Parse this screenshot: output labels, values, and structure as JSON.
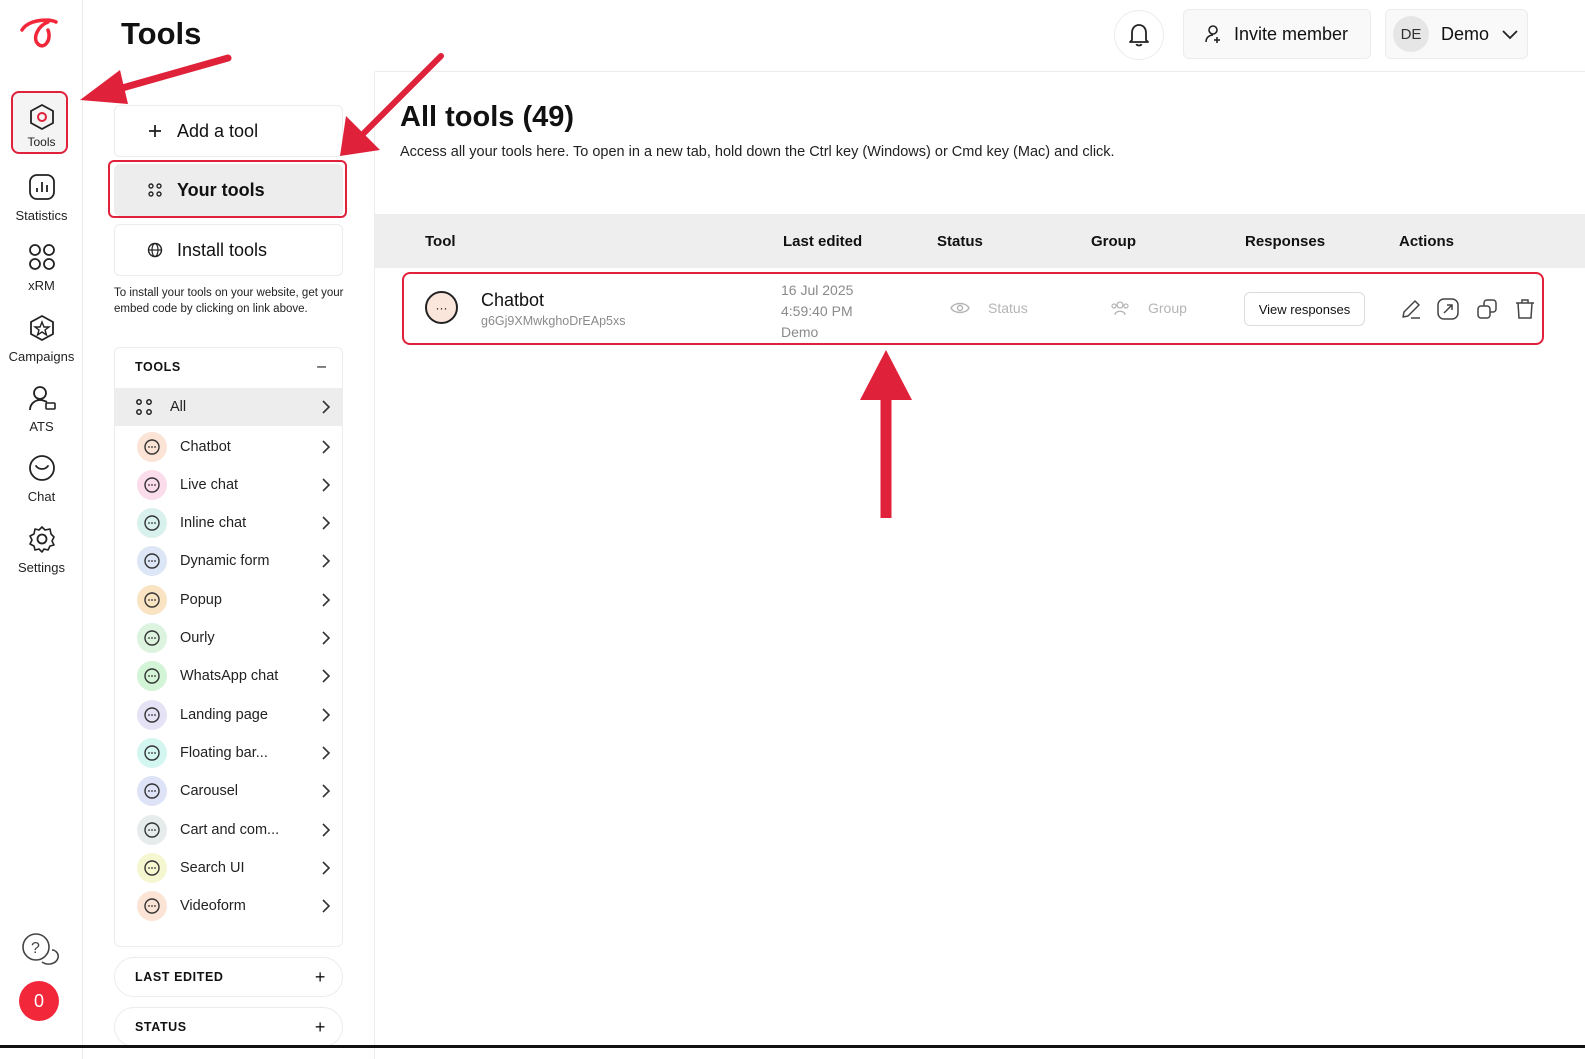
{
  "rail": {
    "items": [
      {
        "label": "Tools",
        "icon": "tools-hex-icon"
      },
      {
        "label": "Statistics",
        "icon": "statistics-icon"
      },
      {
        "label": "xRM",
        "icon": "xrm-grid-icon"
      },
      {
        "label": "Campaigns",
        "icon": "campaigns-icon"
      },
      {
        "label": "ATS",
        "icon": "ats-user-icon"
      },
      {
        "label": "Chat",
        "icon": "chat-icon"
      },
      {
        "label": "Settings",
        "icon": "settings-gear-icon"
      }
    ],
    "badge": "0"
  },
  "header": {
    "title": "Tools",
    "invite_label": "Invite member",
    "user_initials": "DE",
    "user_name": "Demo"
  },
  "sidebar": {
    "add_tool": "Add a tool",
    "your_tools": "Your tools",
    "install_tools": "Install tools",
    "install_note": "To install your tools on your website, get your embed code by clicking on link above.",
    "tools_heading": "TOOLS",
    "tool_types": [
      {
        "label": "All",
        "color": "#ededed"
      },
      {
        "label": "Chatbot",
        "color": "#fbe3d6"
      },
      {
        "label": "Live chat",
        "color": "#fbdcea"
      },
      {
        "label": "Inline chat",
        "color": "#d9f1ec"
      },
      {
        "label": "Dynamic form",
        "color": "#dde6f7"
      },
      {
        "label": "Popup",
        "color": "#f8e3c3"
      },
      {
        "label": "Ourly",
        "color": "#dcf3df"
      },
      {
        "label": "WhatsApp chat",
        "color": "#d3f4d7"
      },
      {
        "label": "Landing page",
        "color": "#e6e2f6"
      },
      {
        "label": "Floating bar...",
        "color": "#d4f6f1"
      },
      {
        "label": "Carousel",
        "color": "#dfe3f7"
      },
      {
        "label": "Cart and com...",
        "color": "#e5eceb"
      },
      {
        "label": "Search UI",
        "color": "#f4f7cf"
      },
      {
        "label": "Videoform",
        "color": "#fbe3d6"
      }
    ],
    "filters": [
      "LAST EDITED",
      "STATUS"
    ]
  },
  "main": {
    "title": "All tools (49)",
    "subtitle": "Access all your tools here. To open in a new tab, hold down the Ctrl key (Windows) or Cmd key (Mac) and click.",
    "columns": [
      "Tool",
      "Last edited",
      "Status",
      "Group",
      "Responses",
      "Actions"
    ],
    "rows": [
      {
        "name": "Chatbot",
        "id": "g6Gj9XMwkghoDrEAp5xs",
        "date": "16 Jul 2025",
        "time": "4:59:40 PM",
        "editor": "Demo",
        "status": "Status",
        "group": "Group",
        "responses_button": "View responses"
      }
    ]
  },
  "colors": {
    "accent": "#e0213a",
    "badge": "#f2283a"
  }
}
